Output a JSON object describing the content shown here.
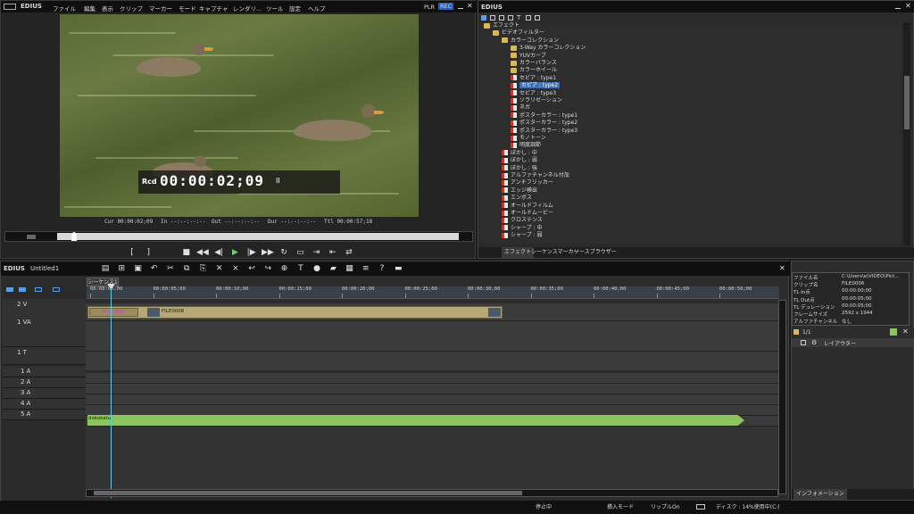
{
  "menubar": {
    "app": "EDIUS",
    "items": [
      "ファイル",
      "編集",
      "表示",
      "クリップ",
      "マーカー",
      "モード",
      "キャプチャ",
      "レンダリ...",
      "ツール",
      "設定",
      "ヘルプ"
    ],
    "plr": "PLR",
    "rec": "REC"
  },
  "player": {
    "rcd_label": "Rcd",
    "timecode": "00:00:02;09",
    "pause_glyph": "II",
    "cur": "Cur 00:00:02;09",
    "in": "In --:--:--:--",
    "out": "Out --:--:--:--",
    "dur": "Dur --:--:--:--",
    "ttl": "Ttl 00:00:57;18"
  },
  "effects": {
    "title": "EDIUS",
    "tree": [
      {
        "label": "エフェクト",
        "level": 0,
        "type": "folder"
      },
      {
        "label": "ビデオフィルター",
        "level": 1,
        "type": "folder"
      },
      {
        "label": "カラーコレクション",
        "level": 2,
        "type": "folder"
      },
      {
        "label": "3-Way カラーコレクション",
        "level": 3,
        "type": "folder"
      },
      {
        "label": "YUVカーブ",
        "level": 3,
        "type": "folder"
      },
      {
        "label": "カラーバランス",
        "level": 3,
        "type": "folder"
      },
      {
        "label": "カラーホイール",
        "level": 3,
        "type": "folder"
      },
      {
        "label": "セピア : type1",
        "level": 3,
        "type": "fx"
      },
      {
        "label": "セピア : type2",
        "level": 3,
        "type": "fx",
        "selected": true
      },
      {
        "label": "セピア : type3",
        "level": 3,
        "type": "fx"
      },
      {
        "label": "ソラリゼーション",
        "level": 3,
        "type": "fx"
      },
      {
        "label": "ネガ",
        "level": 3,
        "type": "fx"
      },
      {
        "label": "ポスターカラー : type1",
        "level": 3,
        "type": "fx"
      },
      {
        "label": "ポスターカラー : type2",
        "level": 3,
        "type": "fx"
      },
      {
        "label": "ポスターカラー : type3",
        "level": 3,
        "type": "fx"
      },
      {
        "label": "モノトーン",
        "level": 3,
        "type": "fx"
      },
      {
        "label": "明度調節",
        "level": 3,
        "type": "fx"
      },
      {
        "label": "ぼかし : 中",
        "level": 2,
        "type": "fx"
      },
      {
        "label": "ぼかし : 弱",
        "level": 2,
        "type": "fx"
      },
      {
        "label": "ぼかし : 強",
        "level": 2,
        "type": "fx"
      },
      {
        "label": "アルファチャンネル付加",
        "level": 2,
        "type": "fx"
      },
      {
        "label": "アンチフリッカー",
        "level": 2,
        "type": "fx"
      },
      {
        "label": "エッジ検出",
        "level": 2,
        "type": "fx"
      },
      {
        "label": "エンボス",
        "level": 2,
        "type": "fx"
      },
      {
        "label": "オールドフィルム",
        "level": 2,
        "type": "fx"
      },
      {
        "label": "オールドムービー",
        "level": 2,
        "type": "fx"
      },
      {
        "label": "クロステンス",
        "level": 2,
        "type": "fx"
      },
      {
        "label": "シャープ : 中",
        "level": 2,
        "type": "fx"
      },
      {
        "label": "シャープ : 弱",
        "level": 2,
        "type": "fx"
      }
    ],
    "tabs": [
      "エフェクト",
      "シーケンスマーカー",
      "ソースブラウザー"
    ]
  },
  "timeline": {
    "app": "EDIUS",
    "project": "Untitled1",
    "sequence_tab": "シーケンス1",
    "ruler": [
      "00:00:00;00",
      "00:00:05;00",
      "00:00:10;00",
      "00:00:15;00",
      "00:00:20;00",
      "00:00:25;00",
      "00:00:30;00",
      "00:00:35;00",
      "00:00:40;00",
      "00:00:45;00",
      "00:00:50;00",
      "00:00:55;00"
    ],
    "tracks": [
      "2 V",
      "1 VA",
      "1 T",
      "1 A",
      "2 A",
      "3 A",
      "4 A",
      "5 A"
    ],
    "clip_v2_a": "FILE0006",
    "clip_v2_b": "FILE0006",
    "clip_audio": "dokokatu"
  },
  "status": {
    "state": "停止中",
    "mode": "挿入モード",
    "ripple": "リップルOn",
    "disk": "ディスク : 14%使用中(C:)"
  },
  "info_panel": {
    "rows": [
      {
        "k": "ファイル名",
        "v": "C:\\Users\\e\\VIDEO\\Pict..."
      },
      {
        "k": "クリップ名",
        "v": "FILE0006"
      },
      {
        "k": "TL In点",
        "v": "00:00:00;00"
      },
      {
        "k": "TL Out点",
        "v": "00:00:05;00"
      },
      {
        "k": "TL デュレーション",
        "v": "00:00:05;00"
      },
      {
        "k": "フレームサイズ",
        "v": "2592 x 1944"
      },
      {
        "k": "アルファチャンネル",
        "v": "なし"
      }
    ],
    "page": "1/1",
    "layout_item": "レイアウター",
    "tab": "インフォメーション"
  },
  "colors": {
    "accent": "#3d6fb6",
    "rec": "#1e5fc8",
    "playhead": "#5ec8e6",
    "audio_clip": "#8cc45e",
    "video_clip": "#b7a774"
  }
}
